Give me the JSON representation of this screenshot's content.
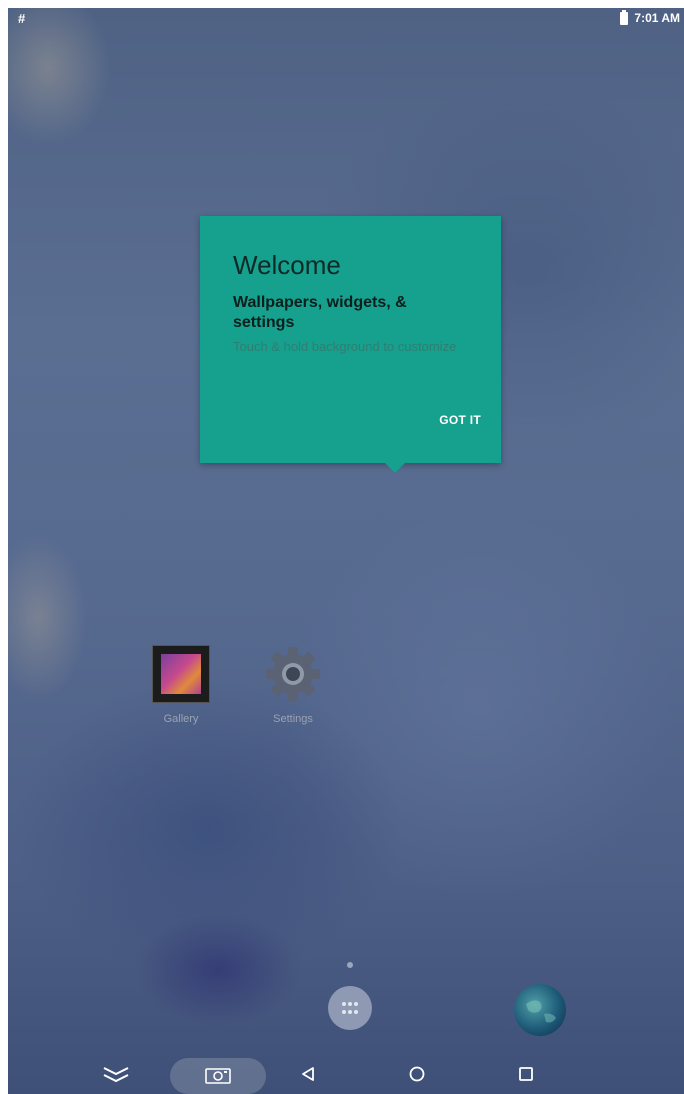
{
  "status_bar": {
    "left_indicator": "#",
    "time": "7:01 AM"
  },
  "welcome_card": {
    "title": "Welcome",
    "subtitle": "Wallpapers, widgets, & settings",
    "body": "Touch & hold background to customize",
    "button_label": "GOT IT",
    "color": "#16a08e"
  },
  "apps": [
    {
      "label": "Gallery",
      "icon": "gallery-icon"
    },
    {
      "label": "Settings",
      "icon": "gear-icon"
    }
  ],
  "dock": {
    "apps_button_icon": "app-drawer-icon",
    "browser_icon": "globe-icon"
  },
  "nav_bar": {
    "items": [
      "hide-keyboard-icon",
      "screenshot-icon",
      "back-icon",
      "home-icon",
      "recents-icon"
    ]
  }
}
